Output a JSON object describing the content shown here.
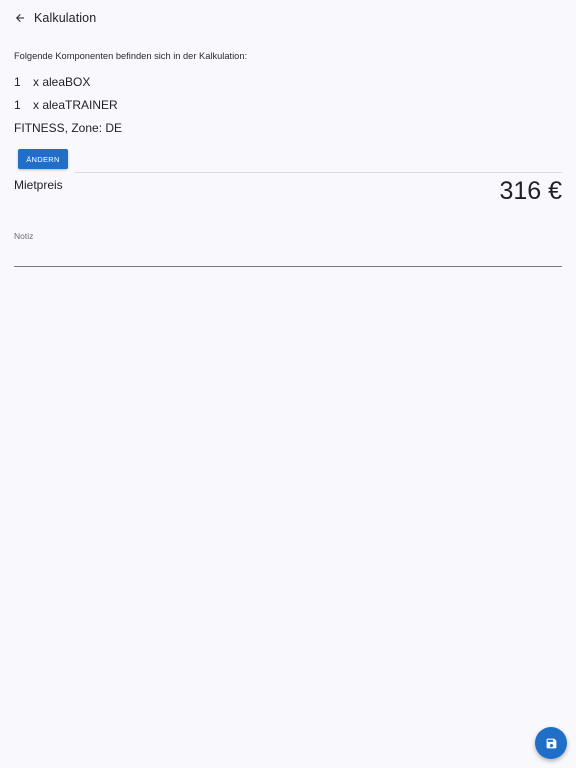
{
  "appbar": {
    "title": "Kalkulation",
    "back_icon": "arrow-left-icon"
  },
  "calculation": {
    "intro": "Folgende Komponenten befinden sich in der Kalkulation:",
    "components": [
      {
        "qty": "1",
        "name": "x aleaBOX"
      },
      {
        "qty": "1",
        "name": "x aleaTRAINER"
      }
    ],
    "zone": "FITNESS, Zone: DE",
    "change_label": "ÄNDERN"
  },
  "price": {
    "label": "Mietpreis",
    "value": "316 €"
  },
  "note": {
    "label": "Notiz",
    "value": ""
  },
  "fab": {
    "icon": "save-icon"
  },
  "colors": {
    "background": "#f9f8fd",
    "accent": "#1f6fc9",
    "text": "#1f1f24"
  }
}
